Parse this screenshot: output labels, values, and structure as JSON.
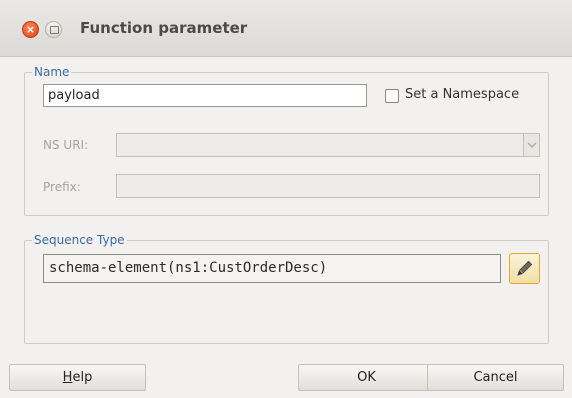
{
  "window": {
    "title": "Function parameter",
    "close_glyph": "×"
  },
  "name_group": {
    "legend": "Name",
    "name_value": "payload",
    "namespace_checkbox_label": "Set a Namespace",
    "namespace_checked": false,
    "ns_uri_label": "NS URI:",
    "ns_uri_value": "",
    "prefix_label": "Prefix:",
    "prefix_value": ""
  },
  "sequence_group": {
    "legend": "Sequence Type",
    "value": "schema-element(ns1:CustOrderDesc)",
    "edit_icon": "pencil-icon"
  },
  "buttons": {
    "help": "Help",
    "ok": "OK",
    "cancel": "Cancel"
  },
  "colors": {
    "legend": "#3d6aa6",
    "close_button": "#e0461a",
    "edit_button_border": "#e3a92f"
  }
}
